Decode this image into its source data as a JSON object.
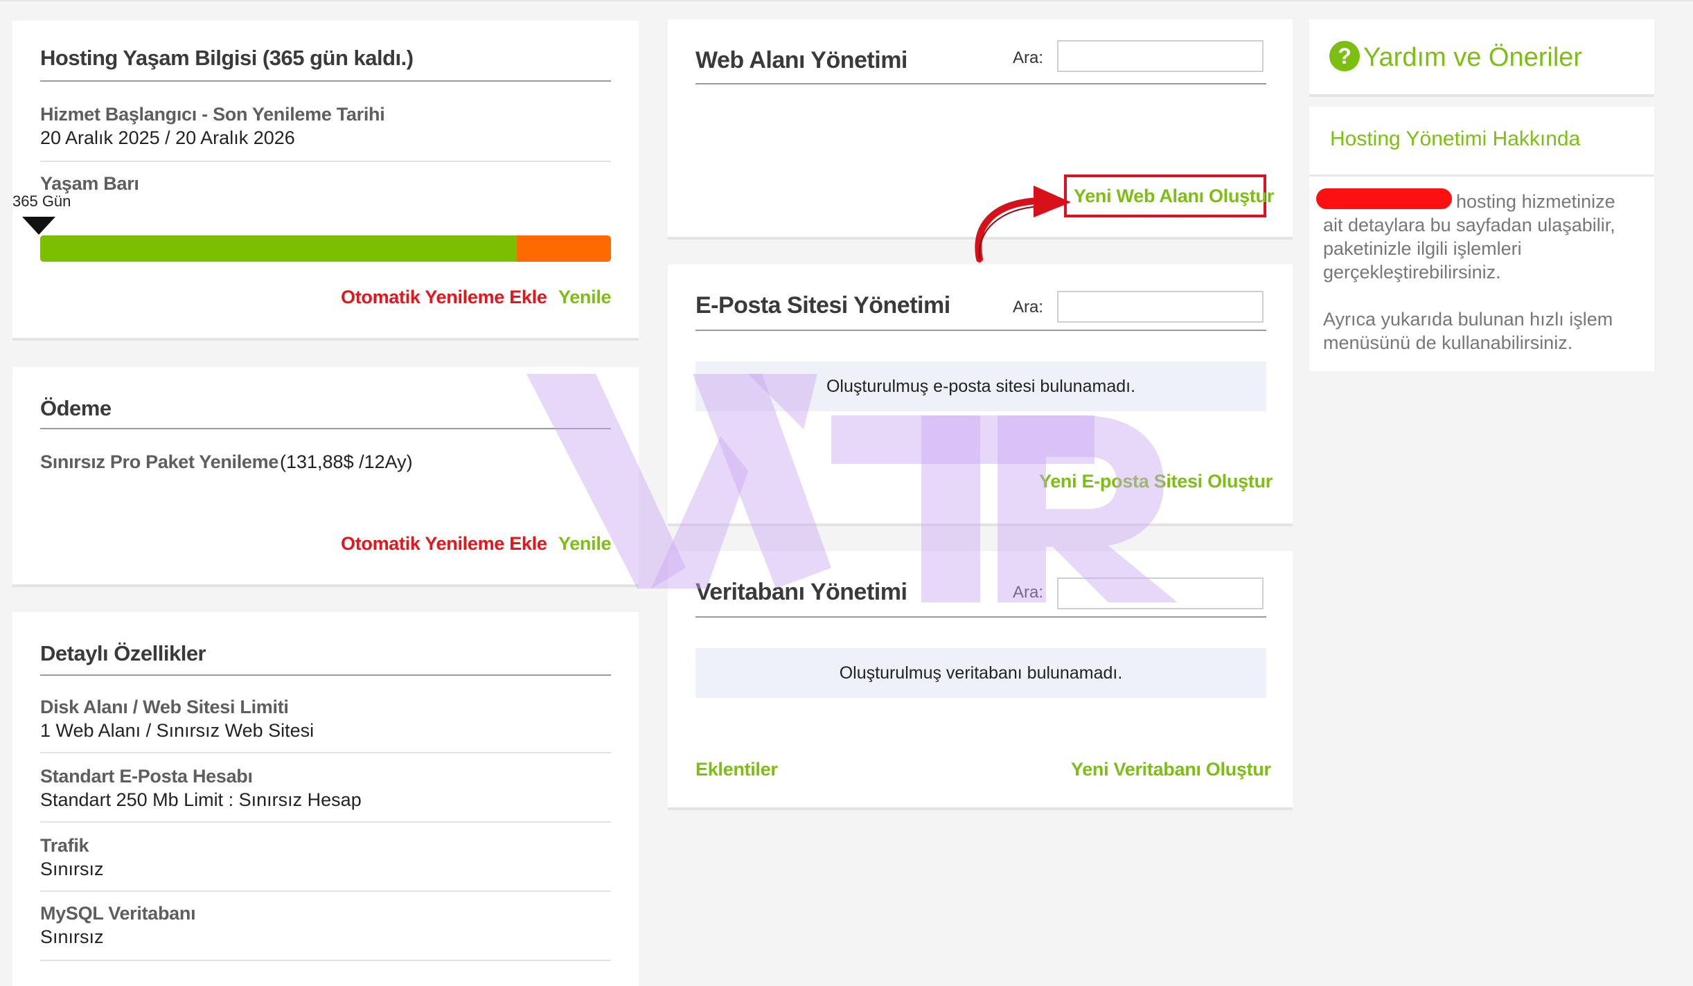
{
  "lifecycle": {
    "title": "Hosting Yaşam Bilgisi (365 gün kaldı.)",
    "dates_label": "Hizmet Başlangıcı - Son Yenileme Tarihi",
    "dates_value": "20 Aralık 2025 / 20 Aralık 2026",
    "bar_label": "Yaşam Barı",
    "marker_label": "365 Gün",
    "bar_green_fraction": 0.835,
    "auto_renew": "Otomatik Yenileme Ekle",
    "renew": "Yenile"
  },
  "payment": {
    "title": "Ödeme",
    "item_label": "Sınırsız Pro Paket Yenileme",
    "item_value": "(131,88$ /12Ay)",
    "auto_renew": "Otomatik Yenileme Ekle",
    "renew": "Yenile"
  },
  "features": {
    "title": "Detaylı Özellikler",
    "items": [
      {
        "label": "Disk Alanı / Web Sitesi Limiti",
        "value": "1 Web Alanı / Sınırsız Web Sitesi"
      },
      {
        "label": "Standart E-Posta Hesabı",
        "value": "Standart 250 Mb Limit : Sınırsız Hesap"
      },
      {
        "label": "Trafik",
        "value": "Sınırsız"
      },
      {
        "label": "MySQL Veritabanı",
        "value": "Sınırsız"
      }
    ]
  },
  "web_space": {
    "title": "Web Alanı Yönetimi",
    "search_label": "Ara:",
    "search_value": "",
    "create": "Yeni Web Alanı Oluştur"
  },
  "email_site": {
    "title": "E-Posta Sitesi Yönetimi",
    "search_label": "Ara:",
    "search_value": "",
    "empty": "Oluşturulmuş e-posta sitesi bulunamadı.",
    "create": "Yeni E-posta Sitesi Oluştur"
  },
  "database": {
    "title": "Veritabanı Yönetimi",
    "search_label": "Ara:",
    "search_value": "",
    "empty": "Oluşturulmuş veritabanı bulunamadı.",
    "plugins": "Eklentiler",
    "create": "Yeni Veritabanı Oluştur"
  },
  "help": {
    "icon": "question-circle-icon",
    "title": "Yardım ve Öneriler",
    "about_title": "Hosting Yönetimi Hakkında",
    "p1_line1": "hosting hizmetinize",
    "p1_line2": "ait detaylara bu sayfadan ulaşabilir,",
    "p1_line3": "paketinizle ilgili işlemleri",
    "p1_line4": "gerçekleştirebilirsiniz.",
    "p2_line1": "Ayrıca yukarıda bulunan hızlı işlem",
    "p2_line2": "menüsünü de kullanabilirsiniz."
  },
  "colors": {
    "accent_green": "#7cbf12",
    "link_red": "#e8141a",
    "bar_green": "#7cbf00",
    "bar_orange": "#ff6a00",
    "highlight_box": "#e0101c"
  }
}
